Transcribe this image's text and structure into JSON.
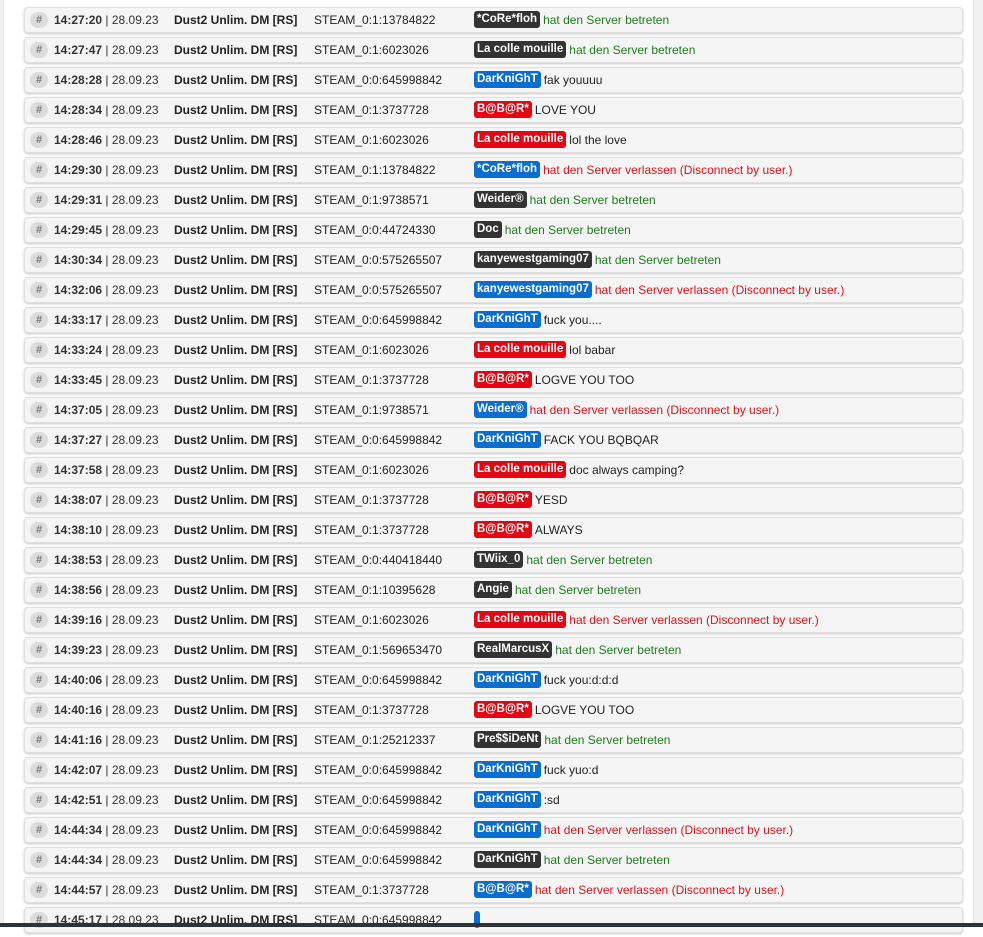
{
  "colors": {
    "badge_dark": "#333333",
    "badge_blue": "#0a6ed1",
    "badge_red": "#e30613",
    "text_join": "#1e7d1e",
    "text_leave": "#d8151b",
    "text_chat": "#222222"
  },
  "icons": {
    "row_marker": "hash-icon"
  },
  "log": [
    {
      "hash": "#",
      "time": "14:27:20",
      "date": "| 28.09.23",
      "server": "Dust2 Unlim. DM [RS]",
      "steam_id": "STEAM_0:1:13784822",
      "player": "*CoRe*floh",
      "badge": "dark",
      "message": "hat den Server betreten",
      "type": "join"
    },
    {
      "hash": "#",
      "time": "14:27:47",
      "date": "| 28.09.23",
      "server": "Dust2 Unlim. DM [RS]",
      "steam_id": "STEAM_0:1:6023026",
      "player": "La colle mouille",
      "badge": "dark",
      "message": "hat den Server betreten",
      "type": "join"
    },
    {
      "hash": "#",
      "time": "14:28:28",
      "date": "| 28.09.23",
      "server": "Dust2 Unlim. DM [RS]",
      "steam_id": "STEAM_0:0:645998842",
      "player": "DarKniGhT",
      "badge": "blue",
      "message": "fak youuuu",
      "type": "chat"
    },
    {
      "hash": "#",
      "time": "14:28:34",
      "date": "| 28.09.23",
      "server": "Dust2 Unlim. DM [RS]",
      "steam_id": "STEAM_0:1:3737728",
      "player": "B@B@R*",
      "badge": "red",
      "message": "LOVE YOU",
      "type": "chat"
    },
    {
      "hash": "#",
      "time": "14:28:46",
      "date": "| 28.09.23",
      "server": "Dust2 Unlim. DM [RS]",
      "steam_id": "STEAM_0:1:6023026",
      "player": "La colle mouille",
      "badge": "red",
      "message": "lol the love",
      "type": "chat"
    },
    {
      "hash": "#",
      "time": "14:29:30",
      "date": "| 28.09.23",
      "server": "Dust2 Unlim. DM [RS]",
      "steam_id": "STEAM_0:1:13784822",
      "player": "*CoRe*floh",
      "badge": "blue",
      "message": "hat den Server verlassen (Disconnect by user.)",
      "type": "leave"
    },
    {
      "hash": "#",
      "time": "14:29:31",
      "date": "| 28.09.23",
      "server": "Dust2 Unlim. DM [RS]",
      "steam_id": "STEAM_0:1:9738571",
      "player": "Weider®",
      "badge": "dark",
      "message": "hat den Server betreten",
      "type": "join"
    },
    {
      "hash": "#",
      "time": "14:29:45",
      "date": "| 28.09.23",
      "server": "Dust2 Unlim. DM [RS]",
      "steam_id": "STEAM_0:0:44724330",
      "player": "Doc",
      "badge": "dark",
      "message": "hat den Server betreten",
      "type": "join"
    },
    {
      "hash": "#",
      "time": "14:30:34",
      "date": "| 28.09.23",
      "server": "Dust2 Unlim. DM [RS]",
      "steam_id": "STEAM_0:0:575265507",
      "player": "kanyewestgaming07",
      "badge": "dark",
      "message": "hat den Server betreten",
      "type": "join"
    },
    {
      "hash": "#",
      "time": "14:32:06",
      "date": "| 28.09.23",
      "server": "Dust2 Unlim. DM [RS]",
      "steam_id": "STEAM_0:0:575265507",
      "player": "kanyewestgaming07",
      "badge": "blue",
      "message": "hat den Server verlassen (Disconnect by user.)",
      "type": "leave"
    },
    {
      "hash": "#",
      "time": "14:33:17",
      "date": "| 28.09.23",
      "server": "Dust2 Unlim. DM [RS]",
      "steam_id": "STEAM_0:0:645998842",
      "player": "DarKniGhT",
      "badge": "blue",
      "message": "fuck you....",
      "type": "chat"
    },
    {
      "hash": "#",
      "time": "14:33:24",
      "date": "| 28.09.23",
      "server": "Dust2 Unlim. DM [RS]",
      "steam_id": "STEAM_0:1:6023026",
      "player": "La colle mouille",
      "badge": "red",
      "message": "lol babar",
      "type": "chat"
    },
    {
      "hash": "#",
      "time": "14:33:45",
      "date": "| 28.09.23",
      "server": "Dust2 Unlim. DM [RS]",
      "steam_id": "STEAM_0:1:3737728",
      "player": "B@B@R*",
      "badge": "red",
      "message": "LOGVE YOU TOO",
      "type": "chat"
    },
    {
      "hash": "#",
      "time": "14:37:05",
      "date": "| 28.09.23",
      "server": "Dust2 Unlim. DM [RS]",
      "steam_id": "STEAM_0:1:9738571",
      "player": "Weider®",
      "badge": "blue",
      "message": "hat den Server verlassen (Disconnect by user.)",
      "type": "leave"
    },
    {
      "hash": "#",
      "time": "14:37:27",
      "date": "| 28.09.23",
      "server": "Dust2 Unlim. DM [RS]",
      "steam_id": "STEAM_0:0:645998842",
      "player": "DarKniGhT",
      "badge": "blue",
      "message": "FACK YOU BQBQAR",
      "type": "chat"
    },
    {
      "hash": "#",
      "time": "14:37:58",
      "date": "| 28.09.23",
      "server": "Dust2 Unlim. DM [RS]",
      "steam_id": "STEAM_0:1:6023026",
      "player": "La colle mouille",
      "badge": "red",
      "message": "doc always camping?",
      "type": "chat"
    },
    {
      "hash": "#",
      "time": "14:38:07",
      "date": "| 28.09.23",
      "server": "Dust2 Unlim. DM [RS]",
      "steam_id": "STEAM_0:1:3737728",
      "player": "B@B@R*",
      "badge": "red",
      "message": "YESD",
      "type": "chat"
    },
    {
      "hash": "#",
      "time": "14:38:10",
      "date": "| 28.09.23",
      "server": "Dust2 Unlim. DM [RS]",
      "steam_id": "STEAM_0:1:3737728",
      "player": "B@B@R*",
      "badge": "red",
      "message": "ALWAYS",
      "type": "chat"
    },
    {
      "hash": "#",
      "time": "14:38:53",
      "date": "| 28.09.23",
      "server": "Dust2 Unlim. DM [RS]",
      "steam_id": "STEAM_0:0:440418440",
      "player": "TWiix_0",
      "badge": "dark",
      "message": "hat den Server betreten",
      "type": "join"
    },
    {
      "hash": "#",
      "time": "14:38:56",
      "date": "| 28.09.23",
      "server": "Dust2 Unlim. DM [RS]",
      "steam_id": "STEAM_0:1:10395628",
      "player": "Angie",
      "badge": "dark",
      "message": "hat den Server betreten",
      "type": "join"
    },
    {
      "hash": "#",
      "time": "14:39:16",
      "date": "| 28.09.23",
      "server": "Dust2 Unlim. DM [RS]",
      "steam_id": "STEAM_0:1:6023026",
      "player": "La colle mouille",
      "badge": "red",
      "message": "hat den Server verlassen (Disconnect by user.)",
      "type": "leave"
    },
    {
      "hash": "#",
      "time": "14:39:23",
      "date": "| 28.09.23",
      "server": "Dust2 Unlim. DM [RS]",
      "steam_id": "STEAM_0:1:569653470",
      "player": "RealMarcusX",
      "badge": "dark",
      "message": "hat den Server betreten",
      "type": "join"
    },
    {
      "hash": "#",
      "time": "14:40:06",
      "date": "| 28.09.23",
      "server": "Dust2 Unlim. DM [RS]",
      "steam_id": "STEAM_0:0:645998842",
      "player": "DarKniGhT",
      "badge": "blue",
      "message": "fuck you:d:d:d",
      "type": "chat"
    },
    {
      "hash": "#",
      "time": "14:40:16",
      "date": "| 28.09.23",
      "server": "Dust2 Unlim. DM [RS]",
      "steam_id": "STEAM_0:1:3737728",
      "player": "B@B@R*",
      "badge": "red",
      "message": "LOGVE YOU TOO",
      "type": "chat"
    },
    {
      "hash": "#",
      "time": "14:41:16",
      "date": "| 28.09.23",
      "server": "Dust2 Unlim. DM [RS]",
      "steam_id": "STEAM_0:1:25212337",
      "player": "Pre$$iDeNt",
      "badge": "dark",
      "message": "hat den Server betreten",
      "type": "join"
    },
    {
      "hash": "#",
      "time": "14:42:07",
      "date": "| 28.09.23",
      "server": "Dust2 Unlim. DM [RS]",
      "steam_id": "STEAM_0:0:645998842",
      "player": "DarKniGhT",
      "badge": "blue",
      "message": "fuck yuo:d",
      "type": "chat"
    },
    {
      "hash": "#",
      "time": "14:42:51",
      "date": "| 28.09.23",
      "server": "Dust2 Unlim. DM [RS]",
      "steam_id": "STEAM_0:0:645998842",
      "player": "DarKniGhT",
      "badge": "blue",
      "message": ":sd",
      "type": "chat"
    },
    {
      "hash": "#",
      "time": "14:44:34",
      "date": "| 28.09.23",
      "server": "Dust2 Unlim. DM [RS]",
      "steam_id": "STEAM_0:0:645998842",
      "player": "DarKniGhT",
      "badge": "blue",
      "message": "hat den Server verlassen (Disconnect by user.)",
      "type": "leave"
    },
    {
      "hash": "#",
      "time": "14:44:34",
      "date": "| 28.09.23",
      "server": "Dust2 Unlim. DM [RS]",
      "steam_id": "STEAM_0:0:645998842",
      "player": "DarKniGhT",
      "badge": "dark",
      "message": "hat den Server betreten",
      "type": "join"
    },
    {
      "hash": "#",
      "time": "14:44:57",
      "date": "| 28.09.23",
      "server": "Dust2 Unlim. DM [RS]",
      "steam_id": "STEAM_0:1:3737728",
      "player": "B@B@R*",
      "badge": "blue",
      "message": "hat den Server verlassen (Disconnect by user.)",
      "type": "leave"
    },
    {
      "hash": "#",
      "time": "14:45:17",
      "date": "| 28.09.23",
      "server": "Dust2 Unlim. DM [RS]",
      "steam_id": "STEAM_0:0:645998842",
      "player": "",
      "badge": "blue",
      "message": "",
      "type": "chat"
    }
  ]
}
